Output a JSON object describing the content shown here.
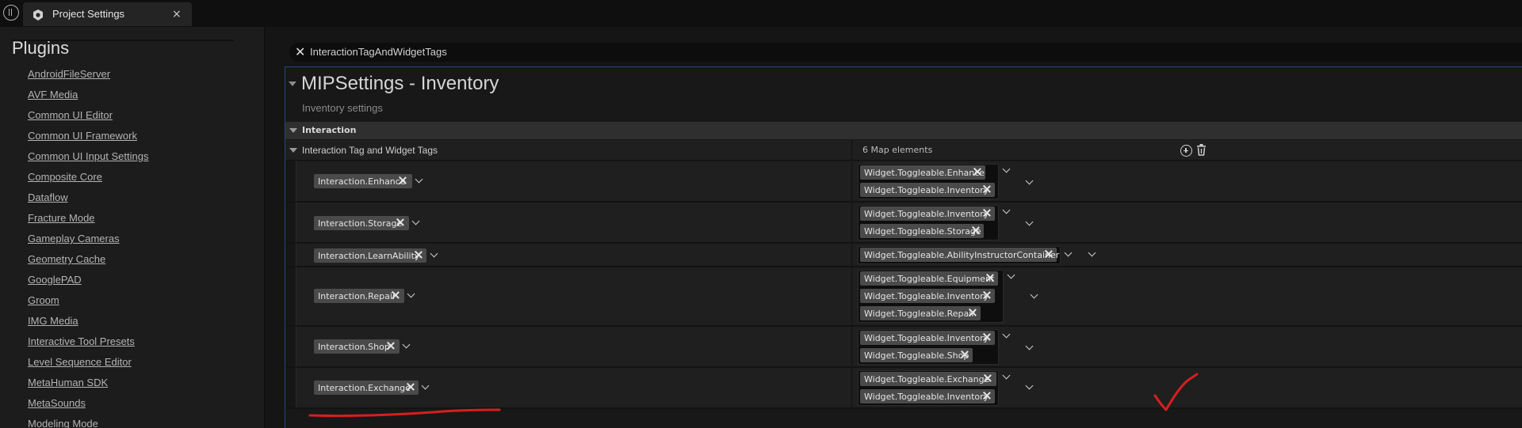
{
  "tab": {
    "title": "Project Settings",
    "icon": "settings-tab-icon",
    "close": "×"
  },
  "sidebar": {
    "heading": "Plugins",
    "items": [
      "AndroidFileServer",
      "AVF Media",
      "Common UI Editor",
      "Common UI Framework",
      "Common UI Input Settings",
      "Composite Core",
      "Dataflow",
      "Fracture Mode",
      "Gameplay Cameras",
      "Geometry Cache",
      "GooglePAD",
      "Groom",
      "IMG Media",
      "Interactive Tool Presets",
      "Level Sequence Editor",
      "MetaHuman SDK",
      "MetaSounds",
      "Modeling Mode"
    ]
  },
  "search": {
    "value": "InteractionTagAndWidgetTags"
  },
  "panel": {
    "title": "MIPSettings - Inventory",
    "subtitle": "Inventory settings",
    "category": "Interaction",
    "property": {
      "label": "Interaction Tag and Widget Tags",
      "count": "6 Map elements"
    },
    "rows": [
      {
        "key": "Interaction.Enhance",
        "values": [
          "Widget.Toggleable.Enhance",
          "Widget.Toggleable.Inventory"
        ]
      },
      {
        "key": "Interaction.Storage",
        "values": [
          "Widget.Toggleable.Inventory",
          "Widget.Toggleable.Storage"
        ]
      },
      {
        "key": "Interaction.LearnAbility",
        "values": [
          "Widget.Toggleable.AbilityInstructorContainer"
        ]
      },
      {
        "key": "Interaction.Repair",
        "values": [
          "Widget.Toggleable.Equipment",
          "Widget.Toggleable.Inventory",
          "Widget.Toggleable.Repair"
        ]
      },
      {
        "key": "Interaction.Shop",
        "values": [
          "Widget.Toggleable.Inventory",
          "Widget.Toggleable.Shop"
        ]
      },
      {
        "key": "Interaction.Exchange",
        "values": [
          "Widget.Toggleable.Exchange",
          "Widget.Toggleable.Inventory"
        ]
      }
    ]
  },
  "colors": {
    "annotation": "#d81e1e",
    "accent_border": "#1f4a7a",
    "chip": "#4a4a4a"
  }
}
